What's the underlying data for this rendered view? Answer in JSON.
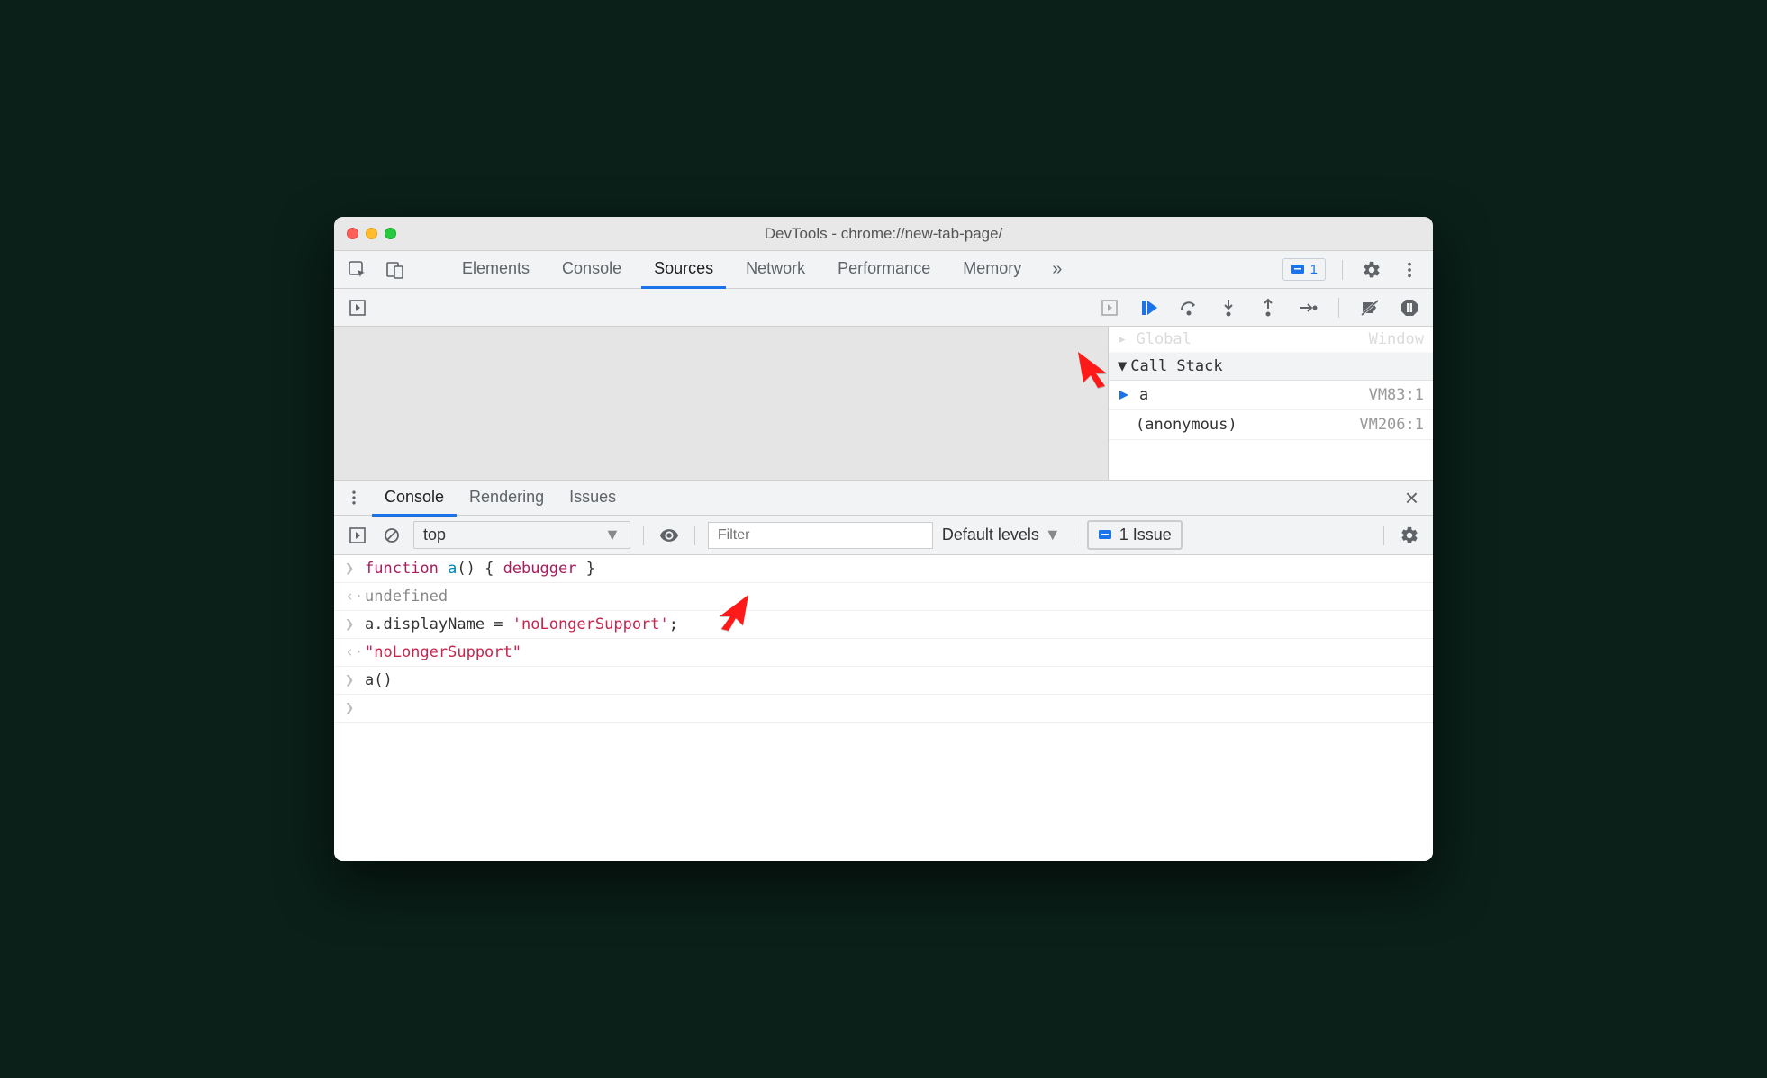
{
  "window": {
    "title": "DevTools - chrome://new-tab-page/"
  },
  "main_tabs": [
    "Elements",
    "Console",
    "Sources",
    "Network",
    "Performance",
    "Memory"
  ],
  "main_active": "Sources",
  "more_tabs_glyph": "»",
  "issue_badge": "1",
  "scope_partial": {
    "left": "▸ Global",
    "right": "Window"
  },
  "callstack": {
    "header": "Call Stack",
    "frames": [
      {
        "fn": "a",
        "loc": "VM83:1",
        "active": true
      },
      {
        "fn": "(anonymous)",
        "loc": "VM206:1",
        "active": false
      }
    ]
  },
  "drawer_tabs": [
    "Console",
    "Rendering",
    "Issues"
  ],
  "drawer_active": "Console",
  "console_toolbar": {
    "context": "top",
    "filter_placeholder": "Filter",
    "levels": "Default levels",
    "issues_label": "1 Issue"
  },
  "console_lines": [
    {
      "gutter": ">",
      "type": "input",
      "tokens": [
        {
          "t": "function ",
          "c": "tok-kw"
        },
        {
          "t": "a",
          "c": "tok-fn"
        },
        {
          "t": "() { ",
          "c": ""
        },
        {
          "t": "debugger",
          "c": "tok-debug"
        },
        {
          "t": " }",
          "c": ""
        }
      ]
    },
    {
      "gutter": "<·",
      "type": "output",
      "tokens": [
        {
          "t": "undefined",
          "c": "tok-undef"
        }
      ]
    },
    {
      "gutter": ">",
      "type": "input",
      "tokens": [
        {
          "t": "a.displayName = ",
          "c": ""
        },
        {
          "t": "'noLongerSupport'",
          "c": "tok-str"
        },
        {
          "t": ";",
          "c": ""
        }
      ]
    },
    {
      "gutter": "<·",
      "type": "output",
      "tokens": [
        {
          "t": "\"noLongerSupport\"",
          "c": "tok-str2"
        }
      ]
    },
    {
      "gutter": ">",
      "type": "input",
      "tokens": [
        {
          "t": "a()",
          "c": ""
        }
      ]
    },
    {
      "gutter": ">",
      "type": "prompt",
      "tokens": []
    }
  ],
  "colors": {
    "accent": "#1a73e8",
    "annot": "#ff0000"
  }
}
